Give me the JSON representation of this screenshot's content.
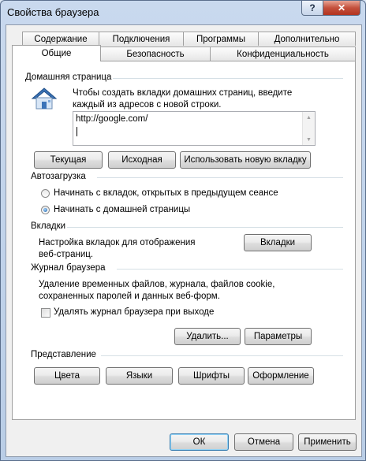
{
  "window": {
    "title": "Свойства браузера"
  },
  "tabs_row1": [
    "Содержание",
    "Подключения",
    "Программы",
    "Дополнительно"
  ],
  "tabs_row2": [
    "Общие",
    "Безопасность",
    "Конфиденциальность"
  ],
  "home": {
    "group": "Домашняя страница",
    "instructions": [
      "Чтобы создать вкладки домашних страниц, введите",
      "каждый из адресов с новой строки."
    ],
    "url": "http://google.com/",
    "buttons": {
      "current": "Текущая",
      "default": "Исходная",
      "new_tab": "Использовать новую вкладку"
    }
  },
  "startup": {
    "group": "Автозагрузка",
    "options": [
      "Начинать с вкладок, открытых в предыдущем сеансе",
      "Начинать с домашней страницы"
    ],
    "selected_index": 1
  },
  "tabs_section": {
    "group": "Вкладки",
    "desc": [
      "Настройка вкладок для отображения",
      "веб-страниц."
    ],
    "button": "Вкладки"
  },
  "history": {
    "group": "Журнал браузера",
    "desc": [
      "Удаление временных файлов, журнала, файлов cookie,",
      "сохраненных паролей и данных веб-форм."
    ],
    "checkbox_label": "Удалять журнал браузера при выходе",
    "checkbox_checked": false,
    "delete_button": "Удалить...",
    "settings_button": "Параметры"
  },
  "appearance": {
    "group": "Представление",
    "buttons": [
      "Цвета",
      "Языки",
      "Шрифты",
      "Оформление"
    ]
  },
  "footer": {
    "ok": "ОК",
    "cancel": "Отмена",
    "apply": "Применить"
  },
  "titlebar_buttons": {
    "help": "?",
    "close": "✕"
  },
  "scroll_arrows": {
    "up": "▲",
    "down": "▼"
  }
}
